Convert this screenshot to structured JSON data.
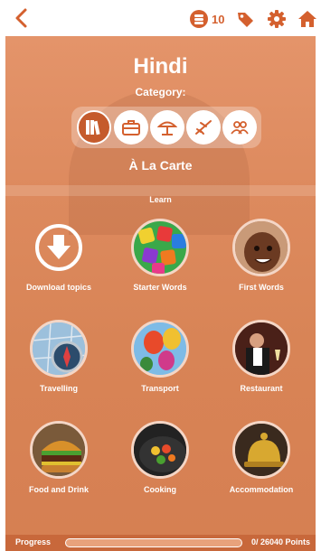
{
  "colors": {
    "accent": "#d4602e",
    "panel": "#dd8a5e",
    "progress_bg": "#c8683b"
  },
  "header": {
    "coins": "10",
    "icons": [
      "back-arrow-icon",
      "coin-stack-icon",
      "tag-icon",
      "gear-icon",
      "home-icon"
    ]
  },
  "language": "Hindi",
  "category_label": "Category:",
  "categories": [
    {
      "icon": "books-icon",
      "active": true
    },
    {
      "icon": "briefcase-icon",
      "active": false
    },
    {
      "icon": "beach-umbrella-icon",
      "active": false
    },
    {
      "icon": "airplane-icon",
      "active": false
    },
    {
      "icon": "people-icon",
      "active": false
    }
  ],
  "subcategory": "À La Carte",
  "section_label": "Learn",
  "topics": [
    {
      "label": "Download topics",
      "icon": "download-icon"
    },
    {
      "label": "Starter Words",
      "icon": "letters-image"
    },
    {
      "label": "First Words",
      "icon": "baby-image"
    },
    {
      "label": "Travelling",
      "icon": "compass-map-image"
    },
    {
      "label": "Transport",
      "icon": "hot-air-balloons-image"
    },
    {
      "label": "Restaurant",
      "icon": "waiter-image"
    },
    {
      "label": "Food and Drink",
      "icon": "burger-image"
    },
    {
      "label": "Cooking",
      "icon": "wok-image"
    },
    {
      "label": "Accommodation",
      "icon": "bell-image"
    }
  ],
  "progress": {
    "label": "Progress",
    "points_text": "0/ 26040 Points",
    "fraction": 0
  }
}
